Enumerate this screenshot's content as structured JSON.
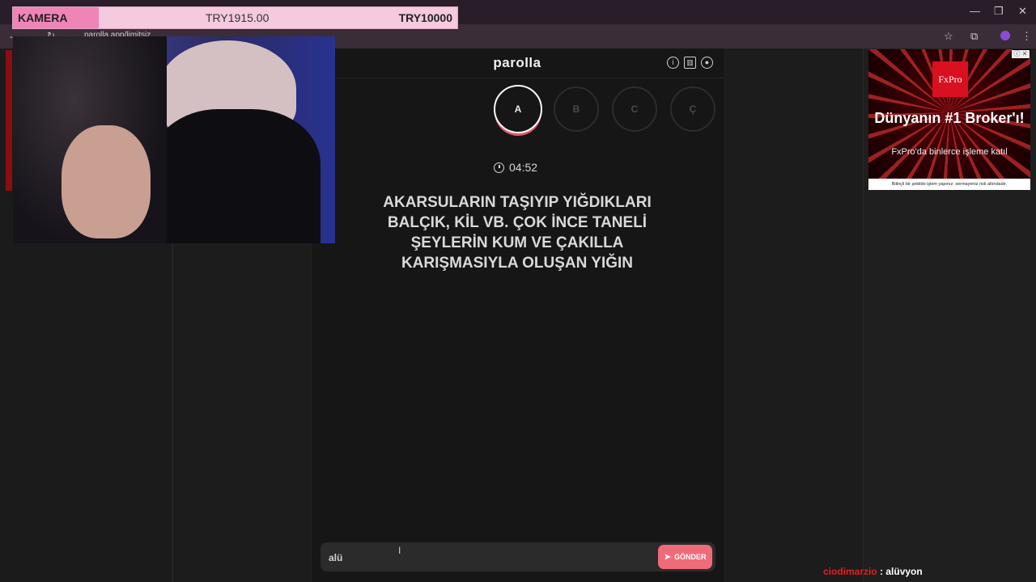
{
  "browser": {
    "url": "parolla.app/limitsiz",
    "minimize_glyph": "—",
    "restore_glyph": "❐",
    "close_glyph": "✕",
    "back_glyph": "←",
    "forward_glyph": "→",
    "reload_glyph": "↻",
    "star_glyph": "☆",
    "extensions_glyph": "⧉",
    "menu_glyph": "⋮"
  },
  "overlay": {
    "kamera_label": "KAMERA",
    "current_amount": "TRY1915.00",
    "goal_amount": "TRY10000"
  },
  "app": {
    "logo": "parolla",
    "header_icons": [
      "info-icon",
      "stats-icon",
      "profile-icon"
    ],
    "letters": [
      {
        "label": "A",
        "active": true
      },
      {
        "label": "B",
        "active": false
      },
      {
        "label": "C",
        "active": false
      },
      {
        "label": "Ç",
        "active": false
      }
    ],
    "timer": "04:52",
    "question": "AKARSULARIN TAŞIYIP YIĞDIKLARI BALÇIK, KİL VB. ÇOK İNCE TANELİ ŞEYLERİN KUM VE ÇAKILLA KARIŞMASIYLA OLUŞAN YIĞIN",
    "answer_value": "alü",
    "send_label": "GÖNDER"
  },
  "ad": {
    "logo": "FxPro",
    "headline": "Dünyanın #1 Broker'ı!",
    "subtext": "FxPro'da binlerce işleme katıl",
    "disclaimer": "Bilinçli bir şekilde işlem yapınız: sermayeniz risk altındadır.",
    "close_label": "ⓘ ✕"
  },
  "chat": {
    "username": "ciodimarzio",
    "separator": " : ",
    "message": "alüvyon"
  },
  "colors": {
    "accent": "#ef6b7a",
    "kamera_bg": "#f5c9de",
    "kamera_label_bg": "#ef84b6",
    "app_bg": "#161616"
  }
}
